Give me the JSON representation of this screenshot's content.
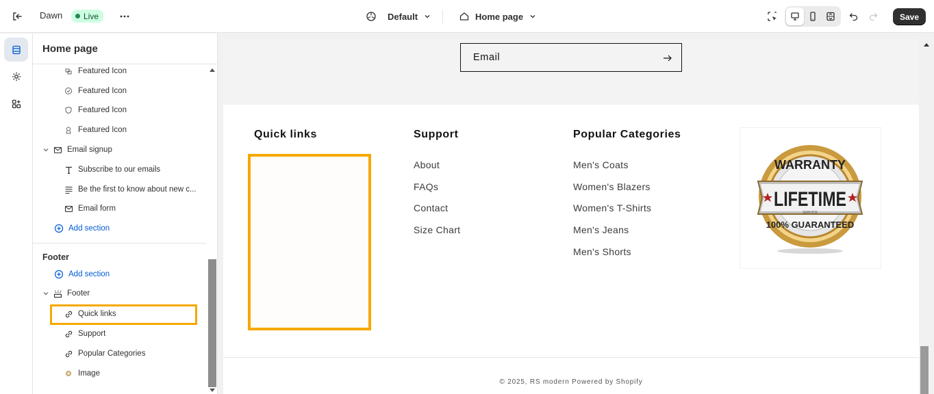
{
  "topbar": {
    "theme_name": "Dawn",
    "live_badge": "Live",
    "more_label": "···",
    "template_label": "Default",
    "page_label": "Home page",
    "save_label": "Save"
  },
  "sidebar": {
    "title": "Home page",
    "items": [
      {
        "label": "Featured Icon"
      },
      {
        "label": "Featured Icon"
      },
      {
        "label": "Featured Icon"
      },
      {
        "label": "Featured Icon"
      },
      {
        "label": "Email signup"
      },
      {
        "label": "Subscribe to our emails"
      },
      {
        "label": "Be the first to know about new c..."
      },
      {
        "label": "Email form"
      },
      {
        "label": "Add section"
      }
    ],
    "footer_group": {
      "heading": "Footer",
      "add_section": "Add section",
      "footer_label": "Footer",
      "blocks": [
        {
          "label": "Quick links"
        },
        {
          "label": "Support"
        },
        {
          "label": "Popular Categories"
        },
        {
          "label": "Image"
        }
      ]
    }
  },
  "preview": {
    "email_placeholder": "Email",
    "arrow": "→",
    "columns": [
      {
        "heading": "Quick links",
        "links": []
      },
      {
        "heading": "Support",
        "links": [
          "About",
          "FAQs",
          "Contact",
          "Size Chart"
        ]
      },
      {
        "heading": "Popular Categories",
        "links": [
          "Men's Coats",
          "Women's Blazers",
          "Women's T-Shirts",
          "Men's Jeans",
          "Men's Shorts"
        ]
      }
    ],
    "badge": {
      "top": "WARRANTY",
      "middle": "LIFETIME",
      "small": "SERVICE",
      "bottom": "100% GUARANTEED"
    },
    "copyright": "© 2025, RS modern Powered by Shopify"
  },
  "colors": {
    "highlight": "#f5a800",
    "live_bg": "#cdfee1",
    "live_dot": "#29845a",
    "link_blue": "#005bd3"
  }
}
